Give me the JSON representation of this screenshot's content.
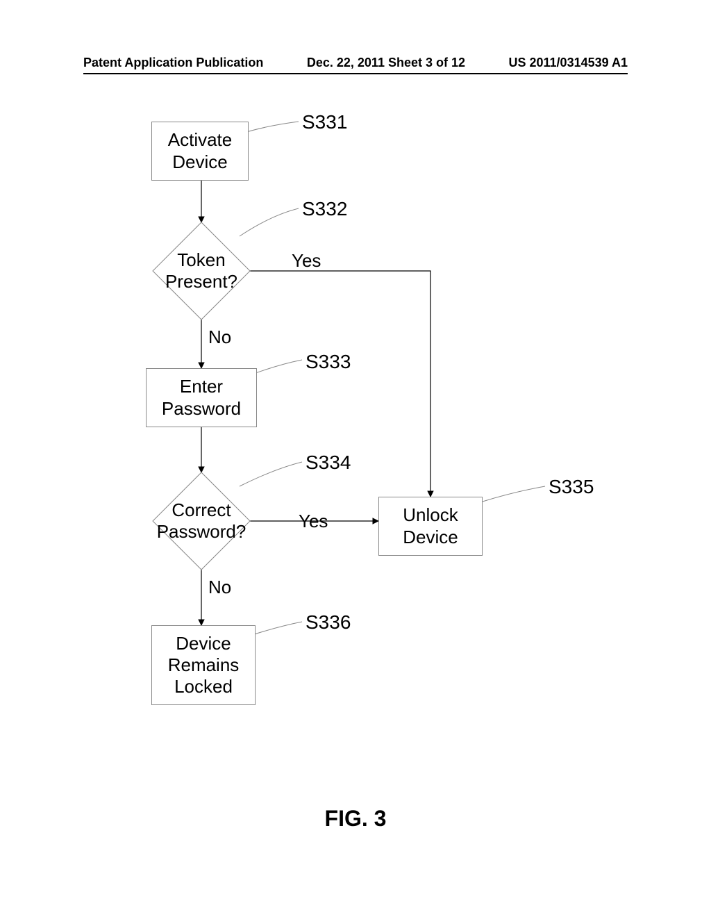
{
  "header": {
    "left": "Patent Application Publication",
    "center": "Dec. 22, 2011  Sheet 3 of 12",
    "right": "US 2011/0314539 A1"
  },
  "figure_label": "FIG. 3",
  "nodes": {
    "s331": {
      "ref": "S331",
      "text_l1": "Activate",
      "text_l2": "Device"
    },
    "s332": {
      "ref": "S332",
      "text_l1": "Token",
      "text_l2": "Present?"
    },
    "s333": {
      "ref": "S333",
      "text_l1": "Enter",
      "text_l2": "Password"
    },
    "s334": {
      "ref": "S334",
      "text_l1": "Correct",
      "text_l2": "Password?"
    },
    "s335": {
      "ref": "S335",
      "text_l1": "Unlock",
      "text_l2": "Device"
    },
    "s336": {
      "ref": "S336",
      "text_l1": "Device",
      "text_l2": "Remains",
      "text_l3": "Locked"
    }
  },
  "edges": {
    "s332_yes": "Yes",
    "s332_no": "No",
    "s334_yes": "Yes",
    "s334_no": "No"
  },
  "chart_data": {
    "type": "flowchart",
    "title": "FIG. 3",
    "nodes": [
      {
        "id": "S331",
        "shape": "process",
        "label": "Activate Device"
      },
      {
        "id": "S332",
        "shape": "decision",
        "label": "Token Present?"
      },
      {
        "id": "S333",
        "shape": "process",
        "label": "Enter Password"
      },
      {
        "id": "S334",
        "shape": "decision",
        "label": "Correct Password?"
      },
      {
        "id": "S335",
        "shape": "process",
        "label": "Unlock Device"
      },
      {
        "id": "S336",
        "shape": "process",
        "label": "Device Remains Locked"
      }
    ],
    "edges": [
      {
        "from": "S331",
        "to": "S332",
        "label": ""
      },
      {
        "from": "S332",
        "to": "S335",
        "label": "Yes"
      },
      {
        "from": "S332",
        "to": "S333",
        "label": "No"
      },
      {
        "from": "S333",
        "to": "S334",
        "label": ""
      },
      {
        "from": "S334",
        "to": "S335",
        "label": "Yes"
      },
      {
        "from": "S334",
        "to": "S336",
        "label": "No"
      }
    ]
  }
}
